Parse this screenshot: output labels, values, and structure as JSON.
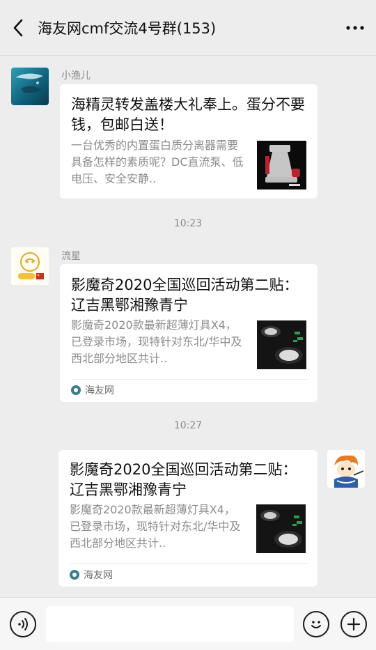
{
  "header": {
    "title": "海友网cmf交流4号群(153)"
  },
  "messages": [
    {
      "sender": "小渔儿",
      "title": "海精灵转发盖楼大礼奉上。蛋分不要钱，包邮白送！",
      "description": "一台优秀的内置蛋白质分离器需要具备怎样的素质呢？DC直流泵、低电压、安全安静..",
      "thumbnail_icon": "protein-skimmer-image"
    },
    {
      "timestamp": "10:23"
    },
    {
      "sender": "流星",
      "title": "影魔奇2020全国巡回活动第二贴： 辽吉黑鄂湘豫青宁",
      "description": "影魔奇2020款最新超薄灯具X4，已登录市场，现特针对东北/华中及西北部分地区共计..",
      "source": "海友网",
      "thumbnail_icon": "led-light-image"
    },
    {
      "timestamp": "10:27"
    },
    {
      "sender": "",
      "title": "影魔奇2020全国巡回活动第二贴： 辽吉黑鄂湘豫青宁",
      "description": "影魔奇2020款最新超薄灯具X4，已登录市场，现特针对东北/华中及西北部分地区共计..",
      "source": "海友网",
      "thumbnail_icon": "led-light-image"
    }
  ],
  "input": {
    "placeholder": ""
  },
  "colors": {
    "background": "#ededed",
    "card": "#ffffff",
    "secondary_text": "#8a8a8a"
  }
}
